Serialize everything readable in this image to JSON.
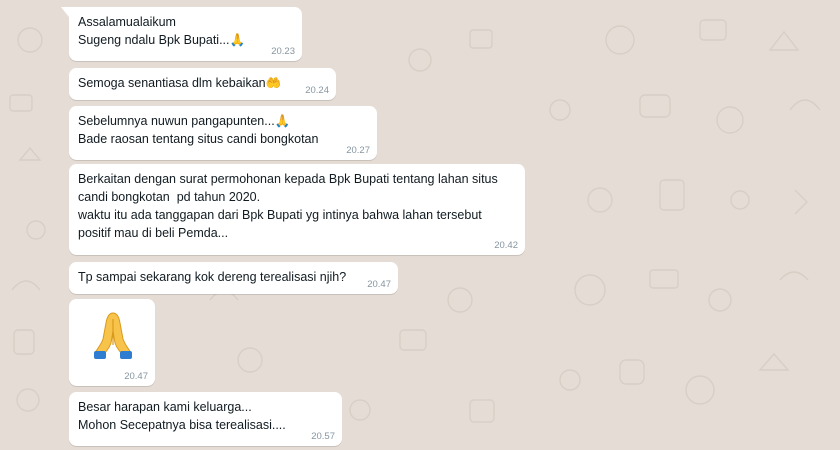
{
  "messages": [
    {
      "text": "Assalamualaikum\nSugeng ndalu Bpk Bupati...🙏",
      "time": "20.23"
    },
    {
      "text": "Semoga senantiasa dlm kebaikan🤲",
      "time": "20.24"
    },
    {
      "text": "Sebelumnya nuwun pangapunten...🙏\nBade raosan tentang situs candi bongkotan",
      "time": "20.27"
    },
    {
      "text": "Berkaitan dengan surat permohonan kepada Bpk Bupati tentang lahan situs\ncandi bongkotan  pd tahun 2020.\nwaktu itu ada tanggapan dari Bpk Bupati yg intinya bahwa lahan tersebut\npositif mau di beli Pemda...",
      "time": "20.42"
    },
    {
      "text": "Tp sampai sekarang kok dereng terealisasi njih?",
      "time": "20.47"
    },
    {
      "emoji": "folded-hands-emoji",
      "time": "20.47"
    },
    {
      "text": "Besar harapan kami keluarga...\nMohon Secepatnya bisa terealisasi....",
      "time": "20.57"
    }
  ],
  "colors": {
    "background": "#e5ddd5",
    "bubble": "#ffffff",
    "timestamp": "#8696a0",
    "text": "#111b21"
  }
}
